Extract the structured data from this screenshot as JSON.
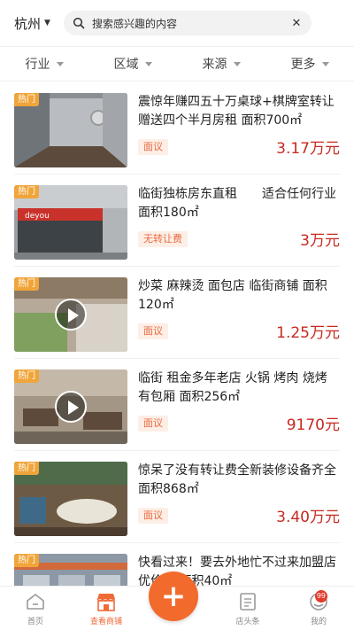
{
  "header": {
    "city": "杭州",
    "search_placeholder": "搜索感兴趣的内容"
  },
  "filters": [
    {
      "label": "行业"
    },
    {
      "label": "区域"
    },
    {
      "label": "来源"
    },
    {
      "label": "更多"
    }
  ],
  "listings": [
    {
      "hot": "热门",
      "title": "震惊年赚四五十万桌球+棋牌室转让赠送四个半月房租 面积700㎡",
      "tag": "面议",
      "price": "3.17万元",
      "video": false
    },
    {
      "hot": "热门",
      "title": "临街独栋房东直租　　适合任何行业 面积180㎡",
      "tag": "无转让费",
      "price": "3万元",
      "video": false
    },
    {
      "hot": "热门",
      "title": "炒菜 麻辣烫 面包店 临街商铺 面积120㎡",
      "tag": "面议",
      "price": "1.25万元",
      "video": true
    },
    {
      "hot": "热门",
      "title": "临街 租金多年老店 火锅 烤肉 烧烤 有包厢 面积256㎡",
      "tag": "面议",
      "price": "9170元",
      "video": true
    },
    {
      "hot": "热门",
      "title": "惊呆了没有转让费全新装修设备齐全 面积868㎡",
      "tag": "面议",
      "price": "3.40万元",
      "video": false
    },
    {
      "hot": "热门",
      "title": "快看过来！要去外地忙不过来加盟店优价转 面积40㎡",
      "tag": "",
      "price": "",
      "video": false
    }
  ],
  "nav": {
    "home": "首页",
    "shops": "查看商铺",
    "headlines": "店头条",
    "mine": "我的",
    "badge": "99",
    "fab": "+"
  },
  "colors": {
    "accent": "#f26a2c",
    "price": "#c8291f",
    "hot": "#f0a53a",
    "tag_bg": "#fdeee6"
  }
}
